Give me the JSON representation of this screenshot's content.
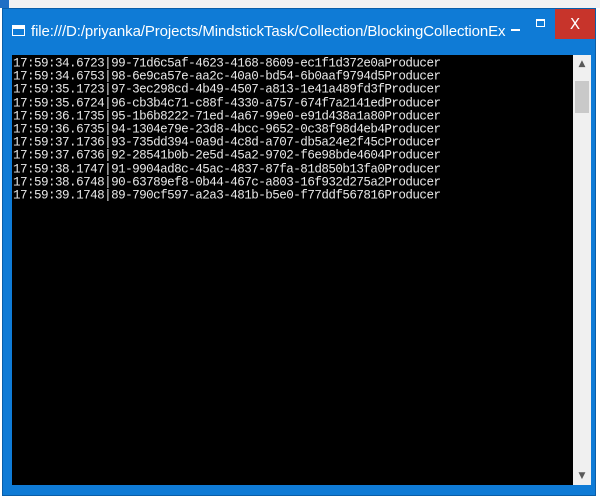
{
  "window": {
    "title": "file:///D:/priyanka/Projects/MindstickTask/Collection/BlockingCollectionExample...",
    "minimize_glyph": "",
    "maximize_glyph": "",
    "close_glyph": "X",
    "accent_color": "#0f7bd6",
    "close_color": "#c7342b"
  },
  "console": {
    "lines": [
      "17:59:34.6723|99-71d6c5af-4623-4168-8609-ec1f1d372e0aProducer",
      "17:59:34.6753|98-6e9ca57e-aa2c-40a0-bd54-6b0aaf9794d5Producer",
      "17:59:35.1723|97-3ec298cd-4b49-4507-a813-1e41a489fd3fProducer",
      "17:59:35.6724|96-cb3b4c71-c88f-4330-a757-674f7a2141edProducer",
      "17:59:36.1735|95-1b6b8222-71ed-4a67-99e0-e91d438a1a80Producer",
      "17:59:36.6735|94-1304e79e-23d8-4bcc-9652-0c38f98d4eb4Producer",
      "17:59:37.1736|93-735dd394-0a9d-4c8d-a707-db5a24e2f45cProducer",
      "17:59:37.6736|92-28541b0b-2e5d-45a2-9702-f6e98bde4604Producer",
      "17:59:38.1747|91-9904ad8c-45ac-4837-87fa-81d850b13fa0Producer",
      "17:59:38.6748|90-63789ef8-0b44-467c-a803-16f932d275a2Producer",
      "17:59:39.1748|89-790cf597-a2a3-481b-b5e0-f77ddf567816Producer"
    ]
  },
  "scrollbar": {
    "up_icon": "▲",
    "down_icon": "▼"
  }
}
